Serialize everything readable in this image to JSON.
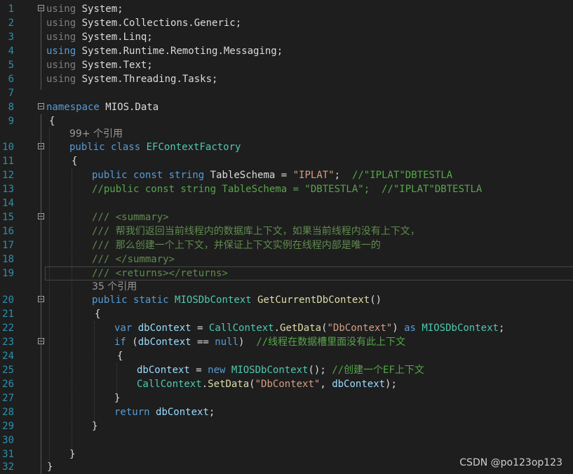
{
  "editor": {
    "line_numbers": [
      "1",
      "2",
      "3",
      "4",
      "5",
      "6",
      "7",
      "8",
      "9",
      "10",
      "11",
      "12",
      "13",
      "14",
      "15",
      "16",
      "17",
      "18",
      "19",
      "20",
      "21",
      "22",
      "23",
      "24",
      "25",
      "26",
      "27",
      "28",
      "29",
      "30",
      "31",
      "32"
    ],
    "code_lens": {
      "class_refs": "99+ 个引用",
      "method_refs": "35 个引用"
    },
    "lines": [
      [
        [
          "dim",
          "using"
        ],
        [
          "pl",
          " System;"
        ]
      ],
      [
        [
          "dim",
          "using"
        ],
        [
          "pl",
          " System.Collections.Generic;"
        ]
      ],
      [
        [
          "dim",
          "using"
        ],
        [
          "pl",
          " System.Linq;"
        ]
      ],
      [
        [
          "kw",
          "using"
        ],
        [
          "pl",
          " System.Runtime.Remoting.Messaging;"
        ]
      ],
      [
        [
          "dim",
          "using"
        ],
        [
          "pl",
          " System.Text;"
        ]
      ],
      [
        [
          "dim",
          "using"
        ],
        [
          "pl",
          " System.Threading.Tasks;"
        ]
      ],
      [],
      [
        [
          "kw",
          "namespace"
        ],
        [
          "pl",
          " MIOS.Data"
        ]
      ],
      [
        [
          "pl",
          "{"
        ]
      ],
      [
        [
          "kw",
          "public"
        ],
        [
          "pl",
          " "
        ],
        [
          "kw",
          "class"
        ],
        [
          "pl",
          " "
        ],
        [
          "ty",
          "EFContextFactory"
        ]
      ],
      [
        [
          "pl",
          "{"
        ]
      ],
      [
        [
          "kw",
          "public"
        ],
        [
          "pl",
          " "
        ],
        [
          "kw",
          "const"
        ],
        [
          "pl",
          " "
        ],
        [
          "kw",
          "string"
        ],
        [
          "pl",
          " TableSchema = "
        ],
        [
          "str",
          "\"IPLAT\""
        ],
        [
          "pl",
          ";  "
        ],
        [
          "cm",
          "//\"IPLAT\"DBTESTLA"
        ]
      ],
      [
        [
          "cm",
          "//public const string TableSchema = \"DBTESTLA\";  //\"IPLAT\"DBTESTLA"
        ]
      ],
      [],
      [
        [
          "xml",
          "/// <summary>"
        ]
      ],
      [
        [
          "xml",
          "/// 帮我们返回当前线程内的数据库上下文，如果当前线程内没有上下文，"
        ]
      ],
      [
        [
          "xml",
          "/// 那么创建一个上下文，并保证上下文实例在线程内部是唯一的"
        ]
      ],
      [
        [
          "xml",
          "/// </summary>"
        ]
      ],
      [
        [
          "xml",
          "/// <returns></returns>"
        ]
      ],
      [
        [
          "kw",
          "public"
        ],
        [
          "pl",
          " "
        ],
        [
          "kw",
          "static"
        ],
        [
          "pl",
          " "
        ],
        [
          "ty",
          "MIOSDbContext"
        ],
        [
          "pl",
          " "
        ],
        [
          "mth",
          "GetCurrentDbContext"
        ],
        [
          "pl",
          "()"
        ]
      ],
      [
        [
          "pl",
          "{"
        ]
      ],
      [
        [
          "kw",
          "var"
        ],
        [
          "pl",
          " "
        ],
        [
          "var",
          "dbContext"
        ],
        [
          "pl",
          " = "
        ],
        [
          "ty",
          "CallContext"
        ],
        [
          "pl",
          "."
        ],
        [
          "mth",
          "GetData"
        ],
        [
          "pl",
          "("
        ],
        [
          "str",
          "\"DbContext\""
        ],
        [
          "pl",
          ") "
        ],
        [
          "kw",
          "as"
        ],
        [
          "pl",
          " "
        ],
        [
          "ty",
          "MIOSDbContext"
        ],
        [
          "pl",
          ";"
        ]
      ],
      [
        [
          "kw",
          "if"
        ],
        [
          "pl",
          " ("
        ],
        [
          "var",
          "dbContext"
        ],
        [
          "pl",
          " == "
        ],
        [
          "kw",
          "null"
        ],
        [
          "pl",
          ")  "
        ],
        [
          "cm",
          "//线程在数据槽里面没有此上下文"
        ]
      ],
      [
        [
          "pl",
          "{"
        ]
      ],
      [
        [
          "var",
          "dbContext"
        ],
        [
          "pl",
          " = "
        ],
        [
          "kw",
          "new"
        ],
        [
          "pl",
          " "
        ],
        [
          "ty",
          "MIOSDbContext"
        ],
        [
          "pl",
          "(); "
        ],
        [
          "cm",
          "//创建一个EF上下文"
        ]
      ],
      [
        [
          "ty",
          "CallContext"
        ],
        [
          "pl",
          "."
        ],
        [
          "mth",
          "SetData"
        ],
        [
          "pl",
          "("
        ],
        [
          "str",
          "\"DbContext\""
        ],
        [
          "pl",
          ", "
        ],
        [
          "var",
          "dbContext"
        ],
        [
          "pl",
          ");"
        ]
      ],
      [
        [
          "pl",
          "}"
        ]
      ],
      [
        [
          "kw",
          "return"
        ],
        [
          "pl",
          " "
        ],
        [
          "var",
          "dbContext"
        ],
        [
          "pl",
          ";"
        ]
      ],
      [
        [
          "pl",
          "}"
        ]
      ],
      [],
      [
        [
          "pl",
          "}"
        ]
      ],
      [
        [
          "pl",
          "}"
        ]
      ]
    ]
  },
  "watermark": "CSDN @po123op123",
  "colors": {
    "background": "#1e1e1e",
    "line_number": "#2b91af",
    "keyword": "#569cd6",
    "type": "#4ec9b0",
    "string": "#d69d85",
    "comment": "#57a64a",
    "doc_comment": "#608b4e",
    "method": "#dcdcaa",
    "variable": "#9cdcfe"
  },
  "icons": [
    "collapse-icon"
  ]
}
